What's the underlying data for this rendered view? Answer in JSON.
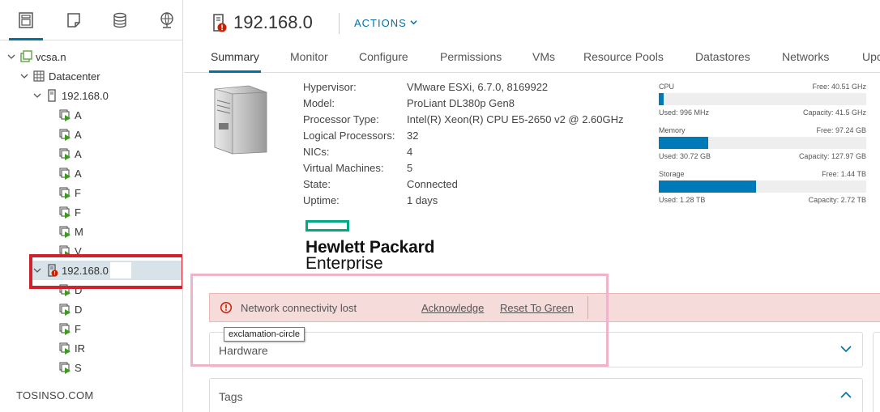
{
  "nav": {
    "tabs": [
      {
        "icon": "hosts-clusters-icon",
        "active": true
      },
      {
        "icon": "vms-templates-icon",
        "active": false
      },
      {
        "icon": "storage-icon",
        "active": false
      },
      {
        "icon": "networking-icon",
        "active": false
      }
    ],
    "tree": [
      {
        "label": "vcsa.n",
        "icon": "vcenter-icon"
      },
      {
        "label": "Datacenter",
        "icon": "datacenter-icon"
      },
      {
        "label": "192.168.0",
        "icon": "host-icon"
      },
      {
        "label": "A",
        "icon": "vm-icon"
      },
      {
        "label": "A",
        "icon": "vm-icon"
      },
      {
        "label": "A",
        "icon": "vm-icon"
      },
      {
        "label": "A",
        "icon": "vm-icon"
      },
      {
        "label": "F",
        "icon": "vm-icon"
      },
      {
        "label": "F",
        "icon": "vm-icon"
      },
      {
        "label": "M",
        "icon": "vm-icon"
      },
      {
        "label": "V",
        "icon": "vm-icon"
      },
      {
        "label": "192.168.0",
        "icon": "host-alert-icon"
      },
      {
        "label": "D",
        "icon": "vm-icon"
      },
      {
        "label": "D",
        "icon": "vm-icon"
      },
      {
        "label": "F",
        "icon": "vm-icon"
      },
      {
        "label": "IR",
        "icon": "vm-icon"
      },
      {
        "label": "S",
        "icon": "vm-icon"
      }
    ]
  },
  "watermark": "TOSINSO.COM",
  "header": {
    "title": "192.168.0.",
    "actions_label": "ACTIONS"
  },
  "tabs": [
    "Summary",
    "Monitor",
    "Configure",
    "Permissions",
    "VMs",
    "Resource Pools",
    "Datastores",
    "Networks",
    "Upc"
  ],
  "properties": [
    {
      "key": "Hypervisor:",
      "value": "VMware ESXi, 6.7.0, 8169922"
    },
    {
      "key": "Model:",
      "value": "ProLiant DL380p Gen8"
    },
    {
      "key": "Processor Type:",
      "value": "Intel(R) Xeon(R) CPU E5-2650 v2 @ 2.60GHz"
    },
    {
      "key": "Logical Processors:",
      "value": "32"
    },
    {
      "key": "NICs:",
      "value": "4"
    },
    {
      "key": "Virtual Machines:",
      "value": "5"
    },
    {
      "key": "State:",
      "value": "Connected"
    },
    {
      "key": "Uptime:",
      "value": "1 days"
    }
  ],
  "vendor_logo": {
    "line1": "Hewlett Packard",
    "line2": "Enterprise",
    "accent": "#01a982"
  },
  "resources": [
    {
      "name": "CPU",
      "free": "Free: 40.51 GHz",
      "used": "Used: 996 MHz",
      "capacity": "Capacity: 41.5 GHz",
      "fraction": 0.024
    },
    {
      "name": "Memory",
      "free": "Free: 97.24 GB",
      "used": "Used: 30.72 GB",
      "capacity": "Capacity: 127.97 GB",
      "fraction": 0.24
    },
    {
      "name": "Storage",
      "free": "Free: 1.44 TB",
      "used": "Used: 1.28 TB",
      "capacity": "Capacity: 2.72 TB",
      "fraction": 0.47
    }
  ],
  "alert": {
    "message": "Network connectivity lost",
    "acknowledge": "Acknowledge",
    "reset": "Reset To Green",
    "tooltip": "exclamation-circle",
    "bg": "#f5dbd9"
  },
  "cards": {
    "hardware": "Hardware",
    "tags": "Tags"
  },
  "colors": {
    "accent": "#0072a3",
    "bar": "#0079b8",
    "highlight_red": "#d0222d",
    "highlight_pink": "#f0b3c9"
  }
}
